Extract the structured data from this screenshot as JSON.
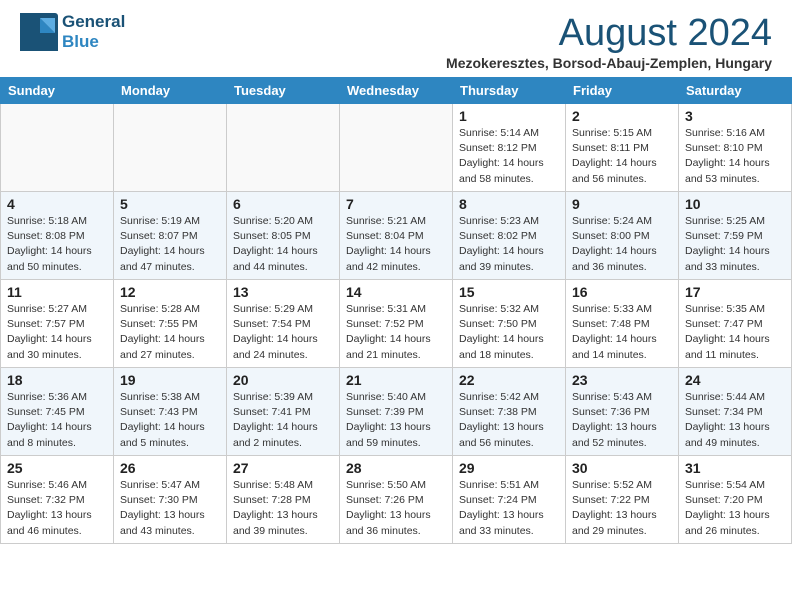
{
  "header": {
    "logo_line1": "General",
    "logo_line2": "Blue",
    "month_year": "August 2024",
    "location": "Mezokeresztes, Borsod-Abauj-Zemplen, Hungary"
  },
  "weekdays": [
    "Sunday",
    "Monday",
    "Tuesday",
    "Wednesday",
    "Thursday",
    "Friday",
    "Saturday"
  ],
  "weeks": [
    [
      {
        "day": "",
        "info": ""
      },
      {
        "day": "",
        "info": ""
      },
      {
        "day": "",
        "info": ""
      },
      {
        "day": "",
        "info": ""
      },
      {
        "day": "1",
        "info": "Sunrise: 5:14 AM\nSunset: 8:12 PM\nDaylight: 14 hours\nand 58 minutes."
      },
      {
        "day": "2",
        "info": "Sunrise: 5:15 AM\nSunset: 8:11 PM\nDaylight: 14 hours\nand 56 minutes."
      },
      {
        "day": "3",
        "info": "Sunrise: 5:16 AM\nSunset: 8:10 PM\nDaylight: 14 hours\nand 53 minutes."
      }
    ],
    [
      {
        "day": "4",
        "info": "Sunrise: 5:18 AM\nSunset: 8:08 PM\nDaylight: 14 hours\nand 50 minutes."
      },
      {
        "day": "5",
        "info": "Sunrise: 5:19 AM\nSunset: 8:07 PM\nDaylight: 14 hours\nand 47 minutes."
      },
      {
        "day": "6",
        "info": "Sunrise: 5:20 AM\nSunset: 8:05 PM\nDaylight: 14 hours\nand 44 minutes."
      },
      {
        "day": "7",
        "info": "Sunrise: 5:21 AM\nSunset: 8:04 PM\nDaylight: 14 hours\nand 42 minutes."
      },
      {
        "day": "8",
        "info": "Sunrise: 5:23 AM\nSunset: 8:02 PM\nDaylight: 14 hours\nand 39 minutes."
      },
      {
        "day": "9",
        "info": "Sunrise: 5:24 AM\nSunset: 8:00 PM\nDaylight: 14 hours\nand 36 minutes."
      },
      {
        "day": "10",
        "info": "Sunrise: 5:25 AM\nSunset: 7:59 PM\nDaylight: 14 hours\nand 33 minutes."
      }
    ],
    [
      {
        "day": "11",
        "info": "Sunrise: 5:27 AM\nSunset: 7:57 PM\nDaylight: 14 hours\nand 30 minutes."
      },
      {
        "day": "12",
        "info": "Sunrise: 5:28 AM\nSunset: 7:55 PM\nDaylight: 14 hours\nand 27 minutes."
      },
      {
        "day": "13",
        "info": "Sunrise: 5:29 AM\nSunset: 7:54 PM\nDaylight: 14 hours\nand 24 minutes."
      },
      {
        "day": "14",
        "info": "Sunrise: 5:31 AM\nSunset: 7:52 PM\nDaylight: 14 hours\nand 21 minutes."
      },
      {
        "day": "15",
        "info": "Sunrise: 5:32 AM\nSunset: 7:50 PM\nDaylight: 14 hours\nand 18 minutes."
      },
      {
        "day": "16",
        "info": "Sunrise: 5:33 AM\nSunset: 7:48 PM\nDaylight: 14 hours\nand 14 minutes."
      },
      {
        "day": "17",
        "info": "Sunrise: 5:35 AM\nSunset: 7:47 PM\nDaylight: 14 hours\nand 11 minutes."
      }
    ],
    [
      {
        "day": "18",
        "info": "Sunrise: 5:36 AM\nSunset: 7:45 PM\nDaylight: 14 hours\nand 8 minutes."
      },
      {
        "day": "19",
        "info": "Sunrise: 5:38 AM\nSunset: 7:43 PM\nDaylight: 14 hours\nand 5 minutes."
      },
      {
        "day": "20",
        "info": "Sunrise: 5:39 AM\nSunset: 7:41 PM\nDaylight: 14 hours\nand 2 minutes."
      },
      {
        "day": "21",
        "info": "Sunrise: 5:40 AM\nSunset: 7:39 PM\nDaylight: 13 hours\nand 59 minutes."
      },
      {
        "day": "22",
        "info": "Sunrise: 5:42 AM\nSunset: 7:38 PM\nDaylight: 13 hours\nand 56 minutes."
      },
      {
        "day": "23",
        "info": "Sunrise: 5:43 AM\nSunset: 7:36 PM\nDaylight: 13 hours\nand 52 minutes."
      },
      {
        "day": "24",
        "info": "Sunrise: 5:44 AM\nSunset: 7:34 PM\nDaylight: 13 hours\nand 49 minutes."
      }
    ],
    [
      {
        "day": "25",
        "info": "Sunrise: 5:46 AM\nSunset: 7:32 PM\nDaylight: 13 hours\nand 46 minutes."
      },
      {
        "day": "26",
        "info": "Sunrise: 5:47 AM\nSunset: 7:30 PM\nDaylight: 13 hours\nand 43 minutes."
      },
      {
        "day": "27",
        "info": "Sunrise: 5:48 AM\nSunset: 7:28 PM\nDaylight: 13 hours\nand 39 minutes."
      },
      {
        "day": "28",
        "info": "Sunrise: 5:50 AM\nSunset: 7:26 PM\nDaylight: 13 hours\nand 36 minutes."
      },
      {
        "day": "29",
        "info": "Sunrise: 5:51 AM\nSunset: 7:24 PM\nDaylight: 13 hours\nand 33 minutes."
      },
      {
        "day": "30",
        "info": "Sunrise: 5:52 AM\nSunset: 7:22 PM\nDaylight: 13 hours\nand 29 minutes."
      },
      {
        "day": "31",
        "info": "Sunrise: 5:54 AM\nSunset: 7:20 PM\nDaylight: 13 hours\nand 26 minutes."
      }
    ]
  ]
}
